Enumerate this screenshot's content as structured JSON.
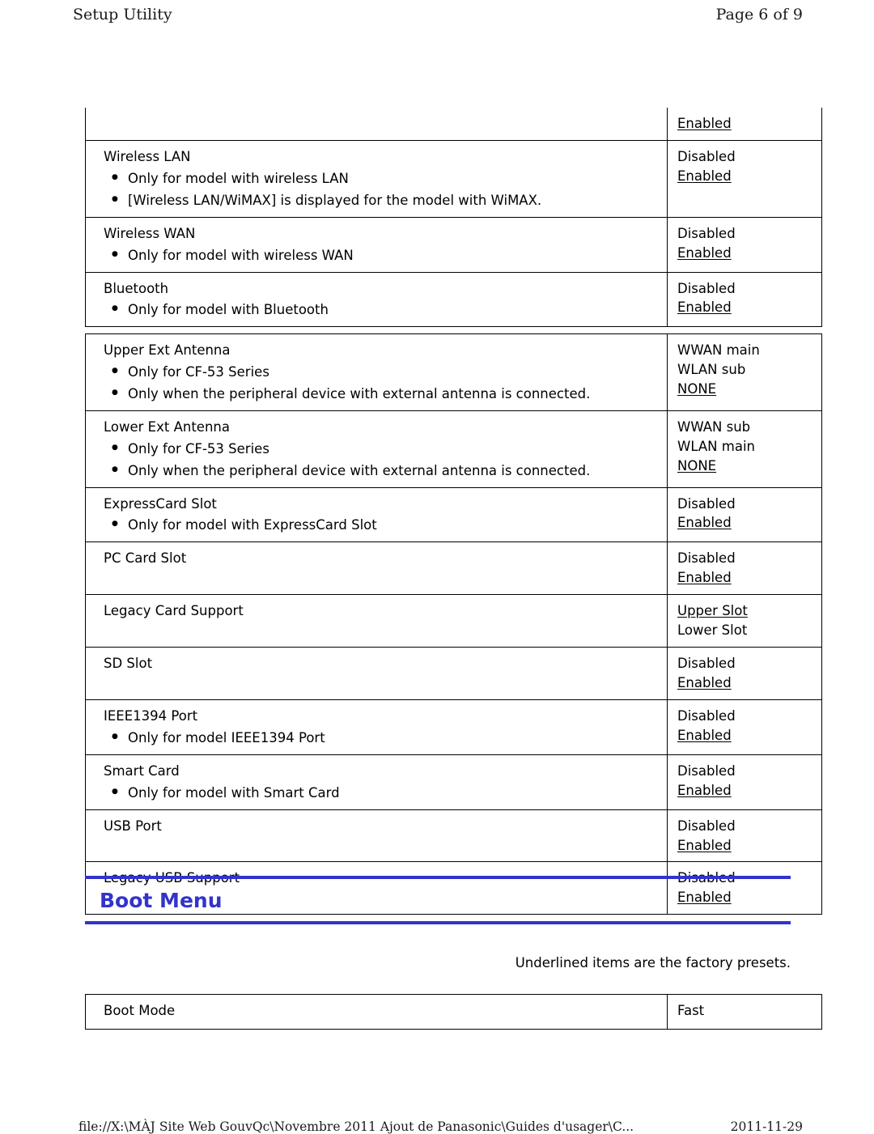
{
  "header": {
    "left": "Setup Utility",
    "right": "Page 6 of 9"
  },
  "footer": {
    "path": "file://X:\\MÀJ Site Web GouvQc\\Novembre 2011 Ajout de Panasonic\\Guides d'usager\\C...",
    "date": "2011-11-29"
  },
  "table_top": {
    "orphan_row": {
      "value": "Enabled"
    },
    "rows": [
      {
        "title": "Wireless LAN",
        "notes": [
          "Only for model with wireless LAN",
          "[Wireless LAN/WiMAX] is displayed for the model with WiMAX."
        ],
        "options": [
          {
            "text": "Disabled",
            "underline": false
          },
          {
            "text": "Enabled",
            "underline": true
          }
        ]
      },
      {
        "title": "Wireless WAN",
        "notes": [
          "Only for model with wireless WAN"
        ],
        "options": [
          {
            "text": "Disabled",
            "underline": false
          },
          {
            "text": "Enabled",
            "underline": true
          }
        ]
      },
      {
        "title": "Bluetooth",
        "notes": [
          "Only for model with Bluetooth"
        ],
        "options": [
          {
            "text": "Disabled",
            "underline": false
          },
          {
            "text": "Enabled",
            "underline": true
          }
        ]
      }
    ]
  },
  "table_main": {
    "rows": [
      {
        "title": "Upper Ext Antenna",
        "notes": [
          "Only for CF-53 Series",
          "Only when the peripheral device with external antenna is connected."
        ],
        "options": [
          {
            "text": "WWAN main",
            "underline": false
          },
          {
            "text": "WLAN sub",
            "underline": false
          },
          {
            "text": "NONE",
            "underline": true
          }
        ]
      },
      {
        "title": "Lower Ext Antenna",
        "notes": [
          "Only for CF-53 Series",
          "Only when the peripheral device with external antenna is connected."
        ],
        "options": [
          {
            "text": "WWAN sub",
            "underline": false
          },
          {
            "text": "WLAN main",
            "underline": false
          },
          {
            "text": "NONE",
            "underline": true
          }
        ]
      },
      {
        "title": "ExpressCard Slot",
        "notes": [
          "Only for model with ExpressCard Slot"
        ],
        "options": [
          {
            "text": "Disabled",
            "underline": false
          },
          {
            "text": "Enabled",
            "underline": true
          }
        ]
      },
      {
        "title": "PC Card Slot",
        "notes": [],
        "options": [
          {
            "text": "Disabled",
            "underline": false
          },
          {
            "text": "Enabled",
            "underline": true
          }
        ]
      },
      {
        "title": "Legacy Card Support",
        "notes": [],
        "options": [
          {
            "text": "Upper Slot",
            "underline": true
          },
          {
            "text": "Lower Slot",
            "underline": false
          }
        ]
      },
      {
        "title": "SD Slot",
        "notes": [],
        "options": [
          {
            "text": "Disabled",
            "underline": false
          },
          {
            "text": "Enabled",
            "underline": true
          }
        ]
      },
      {
        "title": "IEEE1394 Port",
        "notes": [
          "Only for model IEEE1394 Port"
        ],
        "options": [
          {
            "text": "Disabled",
            "underline": false
          },
          {
            "text": "Enabled",
            "underline": true
          }
        ]
      },
      {
        "title": "Smart Card",
        "notes": [
          "Only for model with Smart Card"
        ],
        "options": [
          {
            "text": "Disabled",
            "underline": false
          },
          {
            "text": "Enabled",
            "underline": true
          }
        ]
      },
      {
        "title": "USB Port",
        "notes": [],
        "options": [
          {
            "text": "Disabled",
            "underline": false
          },
          {
            "text": "Enabled",
            "underline": true
          }
        ]
      },
      {
        "title": "Legacy USB Support",
        "notes": [],
        "options": [
          {
            "text": "Disabled",
            "underline": false
          },
          {
            "text": "Enabled",
            "underline": true
          }
        ]
      }
    ]
  },
  "section": {
    "title": "Boot Menu",
    "accent_color": "#3333cc",
    "presets_note": "Underlined items are the factory presets."
  },
  "table_bottom": {
    "rows": [
      {
        "title": "Boot Mode",
        "notes": [],
        "options": [
          {
            "text": "Fast",
            "underline": false
          }
        ]
      }
    ]
  }
}
